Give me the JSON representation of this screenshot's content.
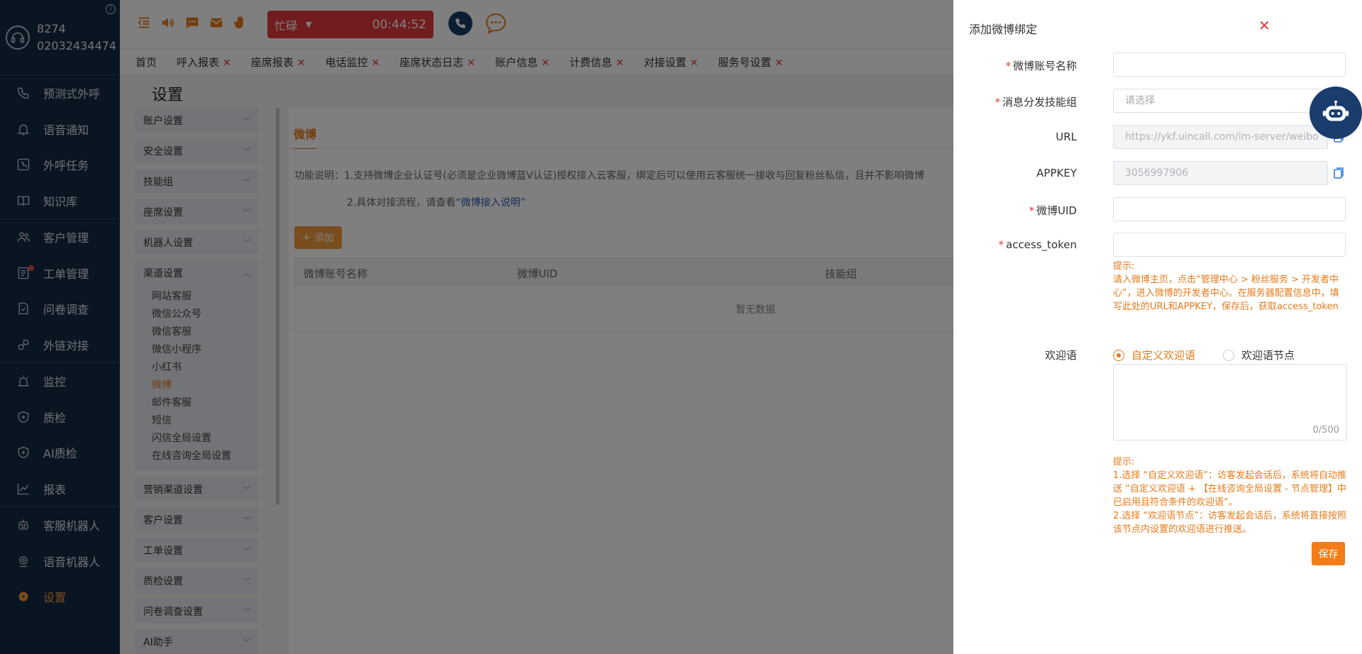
{
  "agent": {
    "id": "8274",
    "phone": "02032434474",
    "info": "i"
  },
  "nav": {
    "items": [
      {
        "label": "预测式外呼",
        "icon": "phone-wave-icon"
      },
      {
        "label": "语音通知",
        "icon": "bell-icon"
      },
      {
        "label": "外呼任务",
        "icon": "phone-task-icon"
      },
      {
        "label": "知识库",
        "icon": "book-icon"
      },
      {
        "label": "客户管理",
        "icon": "users-icon"
      },
      {
        "label": "工单管理",
        "icon": "ticket-icon"
      },
      {
        "label": "问卷调查",
        "icon": "survey-icon"
      },
      {
        "label": "外链对接",
        "icon": "link-icon"
      },
      {
        "label": "监控",
        "icon": "alarm-icon"
      },
      {
        "label": "质检",
        "icon": "shield-check-icon"
      },
      {
        "label": "AI质检",
        "icon": "shield-ai-icon"
      },
      {
        "label": "报表",
        "icon": "chart-line-icon"
      },
      {
        "label": "客服机器人",
        "icon": "robot-icon"
      },
      {
        "label": "语音机器人",
        "icon": "voice-robot-icon"
      },
      {
        "label": "设置",
        "icon": "gear-icon"
      }
    ]
  },
  "topbar": {
    "status": "忙碌",
    "timer": "00:44:52"
  },
  "tabs": [
    "首页",
    "呼入报表",
    "座席报表",
    "电话监控",
    "座席状态日志",
    "账户信息",
    "计费信息",
    "对接设置",
    "服务号设置"
  ],
  "page": {
    "title": "设置"
  },
  "subnav": {
    "groups_top": [
      "账户设置",
      "安全设置",
      "技能组",
      "座席设置",
      "机器人设置"
    ],
    "open_group": "渠道设置",
    "sub_items": [
      "网站客服",
      "微信公众号",
      "微信客服",
      "微信小程序",
      "小红书",
      "微博",
      "邮件客服",
      "短信",
      "闪信全局设置",
      "在线咨询全局设置"
    ],
    "active_sub": "微博",
    "groups_bottom": [
      "营销渠道设置",
      "客户设置",
      "工单设置",
      "质检设置",
      "问卷调查设置",
      "AI助手"
    ]
  },
  "content": {
    "tab": "微博",
    "desc1": "功能说明：1.支持微博企业认证号(必须是企业微博蓝V认证)授权接入云客服，绑定后可以使用云客服统一接收与回复粉丝私信，且并不影响微博",
    "desc2": "2.具体对接流程，请查看",
    "desc2_link": "“微博接入说明”",
    "add_button": "添加",
    "table_headers": [
      "微博账号名称",
      "微博UID",
      "技能组"
    ],
    "empty": "暂无数据"
  },
  "drawer": {
    "title": "添加微博绑定",
    "fields": {
      "account_name": {
        "label": "微博账号名称",
        "value": ""
      },
      "skill_group": {
        "label": "消息分发技能组",
        "placeholder": "请选择"
      },
      "url": {
        "label": "URL",
        "value": "https://ykf.uincall.com/im-server/weibo"
      },
      "appkey": {
        "label": "APPKEY",
        "value": "3056997906"
      },
      "uid": {
        "label": "微博UID",
        "value": ""
      },
      "token": {
        "label": "access_token",
        "value": ""
      }
    },
    "hint1_title": "提示:",
    "hint1_body": "请入微博主页，点击“管理中心 > 粉丝服务 > 开发者中心”，进入微博的开发者中心。在服务器配置信息中，填写此处的URL和APPKEY，保存后，获取access_token",
    "welcome_label": "欢迎语",
    "radio_custom": "自定义欢迎语",
    "radio_node": "欢迎语节点",
    "counter": "0/500",
    "hint2_title": "提示:",
    "hint2_line1": "1.选择 “自定义欢迎语”：访客发起会话后，系统将自动推送 “自定义欢迎语 + 【在线咨询全局设置 - 节点管理】中已启用且符合条件的欢迎语”。",
    "hint2_line2": "2.选择 “欢迎语节点”：访客发起会话后，系统将直接按照该节点内设置的欢迎语进行推送。",
    "save": "保存"
  },
  "colors": {
    "accent": "#e77a19",
    "nav_bg": "#152a45",
    "status_red": "#e3393c",
    "danger": "#e23b3b"
  }
}
